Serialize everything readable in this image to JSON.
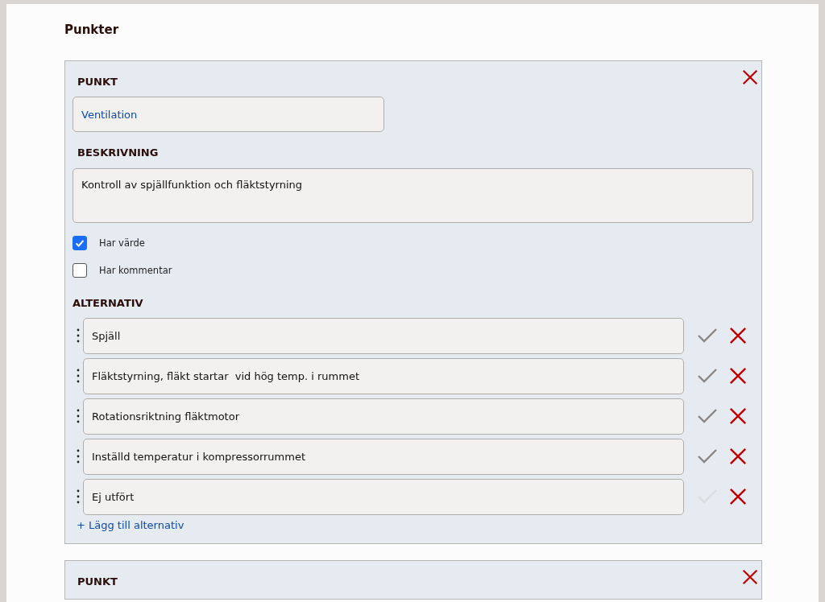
{
  "heading": "Punkter",
  "points": [
    {
      "label": "PUNKT",
      "name": "Ventilation",
      "description_label": "BESKRIVNING",
      "description": "Kontroll av spjällfunktion och fläktstyrning",
      "options": [
        {
          "label": "Har värde",
          "checked": true
        },
        {
          "label": "Har kommentar",
          "checked": false
        }
      ],
      "alternatives_label": "ALTERNATIV",
      "alternatives": [
        {
          "text": "Spjäll",
          "disabled": false
        },
        {
          "text": "Fläktstyrning, fläkt startar  vid hög temp. i rummet",
          "disabled": false
        },
        {
          "text": "Rotationsriktning fläktmotor",
          "disabled": false
        },
        {
          "text": "Inställd temperatur i kompressorrummet",
          "disabled": false
        },
        {
          "text": "Ej utfört",
          "disabled": true
        }
      ],
      "add_link": "+ Lägg till alternativ"
    },
    {
      "label": "PUNKT"
    }
  ]
}
